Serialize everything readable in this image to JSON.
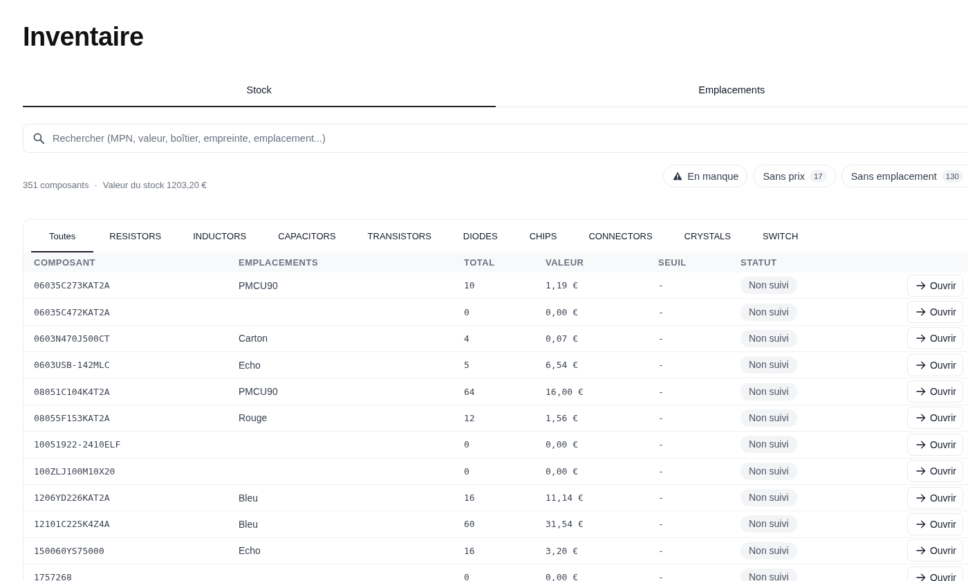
{
  "title": "Inventaire",
  "tabs": [
    {
      "label": "Stock",
      "selected": true
    },
    {
      "label": "Emplacements",
      "selected": false
    }
  ],
  "search": {
    "placeholder": "Rechercher (MPN, valeur, boîtier, empreinte, emplacement...)"
  },
  "summary": {
    "count": "351 composants",
    "separator": "·",
    "value": "Valeur du stock 1203,20 €"
  },
  "filters": [
    {
      "kind": "alert",
      "label": "En manque"
    },
    {
      "kind": "count",
      "label": "Sans prix",
      "count": "17"
    },
    {
      "kind": "count",
      "label": "Sans emplacement",
      "count": "130"
    }
  ],
  "categories": [
    {
      "label": "Toutes",
      "selected": true
    },
    {
      "label": "RESISTORS",
      "selected": false
    },
    {
      "label": "INDUCTORS",
      "selected": false
    },
    {
      "label": "CAPACITORS",
      "selected": false
    },
    {
      "label": "TRANSISTORS",
      "selected": false
    },
    {
      "label": "DIODES",
      "selected": false
    },
    {
      "label": "CHIPS",
      "selected": false
    },
    {
      "label": "CONNECTORS",
      "selected": false
    },
    {
      "label": "CRYSTALS",
      "selected": false
    },
    {
      "label": "SWITCH",
      "selected": false
    }
  ],
  "table": {
    "columns": [
      "COMPOSANT",
      "EMPLACEMENTS",
      "TOTAL",
      "VALEUR",
      "SEUIL",
      "STATUT"
    ],
    "rows": [
      {
        "composant": "06035C273KAT2A",
        "emplacements": "PMCU90",
        "total": "10",
        "valeur": "1,19 €",
        "seuil": "-",
        "statut": "Non suivi",
        "action": "Ouvrir"
      },
      {
        "composant": "06035C472KAT2A",
        "total": "0",
        "valeur": "0,00 €",
        "seuil": "-",
        "statut": "Non suivi",
        "action": "Ouvrir"
      },
      {
        "composant": "0603N470J500CT",
        "emplacements": "Carton",
        "total": "4",
        "valeur": "0,07 €",
        "seuil": "-",
        "statut": "Non suivi",
        "action": "Ouvrir"
      },
      {
        "composant": "0603USB-142MLC",
        "emplacements": "Echo",
        "total": "5",
        "valeur": "6,54 €",
        "seuil": "-",
        "statut": "Non suivi",
        "action": "Ouvrir"
      },
      {
        "composant": "08051C104K4T2A",
        "emplacements": "PMCU90",
        "total": "64",
        "valeur": "16,00 €",
        "seuil": "-",
        "statut": "Non suivi",
        "action": "Ouvrir"
      },
      {
        "composant": "08055F153KAT2A",
        "emplacements": "Rouge",
        "total": "12",
        "valeur": "1,56 €",
        "seuil": "-",
        "statut": "Non suivi",
        "action": "Ouvrir"
      },
      {
        "composant": "10051922-2410ELF",
        "total": "0",
        "valeur": "0,00 €",
        "seuil": "-",
        "statut": "Non suivi",
        "action": "Ouvrir"
      },
      {
        "composant": "100ZLJ100M10X20",
        "total": "0",
        "valeur": "0,00 €",
        "seuil": "-",
        "statut": "Non suivi",
        "action": "Ouvrir"
      },
      {
        "composant": "1206YD226KAT2A",
        "emplacements": "Bleu",
        "total": "16",
        "valeur": "11,14 €",
        "seuil": "-",
        "statut": "Non suivi",
        "action": "Ouvrir"
      },
      {
        "composant": "12101C225K4Z4A",
        "emplacements": "Bleu",
        "total": "60",
        "valeur": "31,54 €",
        "seuil": "-",
        "statut": "Non suivi",
        "action": "Ouvrir"
      },
      {
        "composant": "150060YS75000",
        "emplacements": "Echo",
        "total": "16",
        "valeur": "3,20 €",
        "seuil": "-",
        "statut": "Non suivi",
        "action": "Ouvrir"
      },
      {
        "composant": "1757268",
        "total": "0",
        "valeur": "0,00 €",
        "seuil": "-",
        "statut": "Non suivi",
        "action": "Ouvrir"
      }
    ]
  }
}
